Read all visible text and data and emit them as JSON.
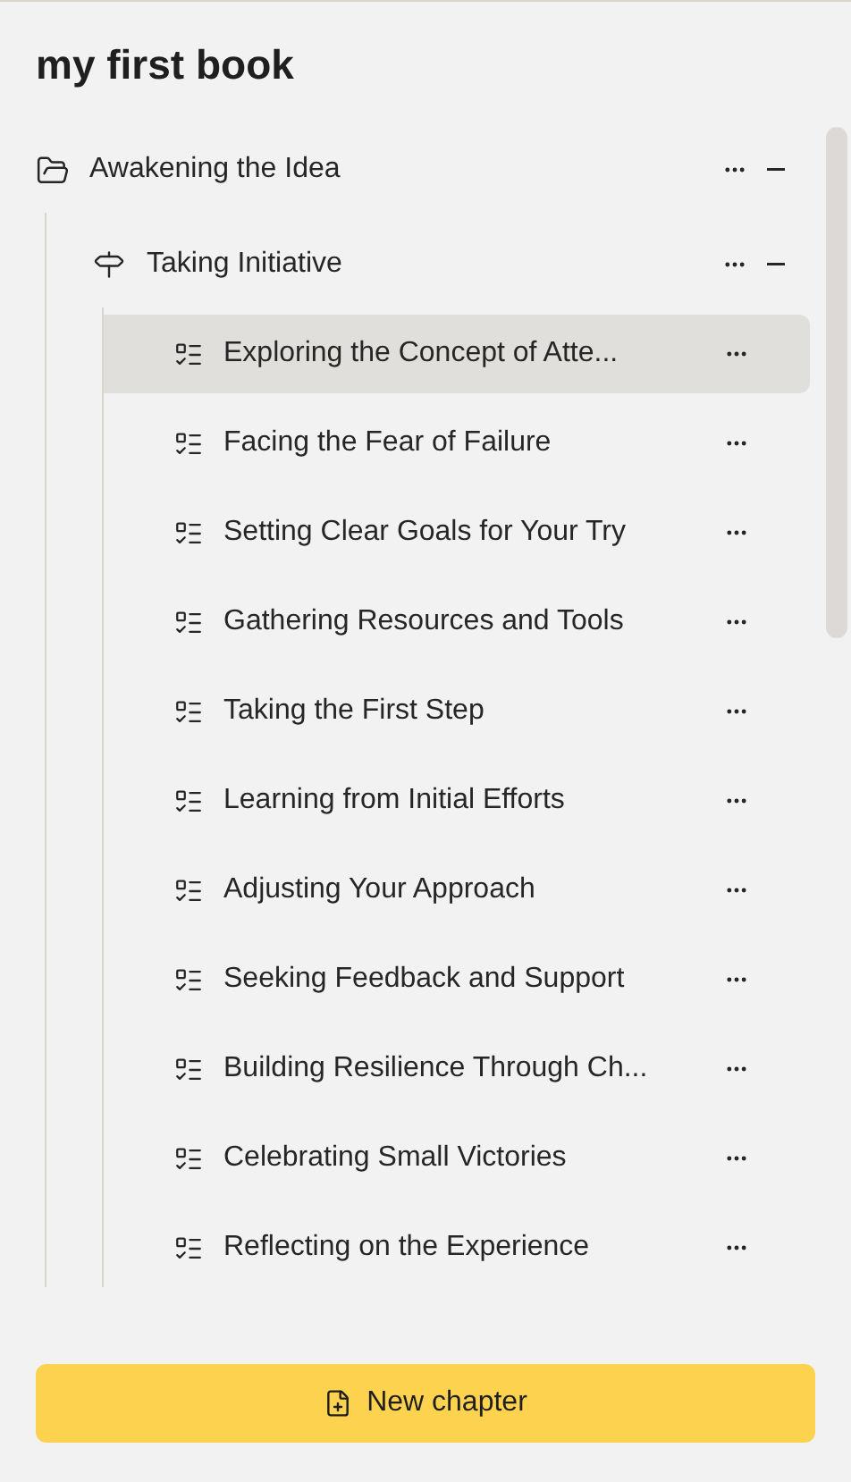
{
  "title": "my first book",
  "tree": [
    {
      "kind": "part",
      "label": "Awakening the Idea",
      "expanded": true,
      "children": [
        {
          "kind": "chapter",
          "label": "Taking Initiative",
          "expanded": true,
          "children": [
            {
              "kind": "section",
              "label": "Exploring the Concept of Atte...",
              "selected": true
            },
            {
              "kind": "section",
              "label": "Facing the Fear of Failure",
              "selected": false
            },
            {
              "kind": "section",
              "label": "Setting Clear Goals for Your Try",
              "selected": false
            },
            {
              "kind": "section",
              "label": "Gathering Resources and Tools",
              "selected": false
            },
            {
              "kind": "section",
              "label": "Taking the First Step",
              "selected": false
            },
            {
              "kind": "section",
              "label": "Learning from Initial Efforts",
              "selected": false
            },
            {
              "kind": "section",
              "label": "Adjusting Your Approach",
              "selected": false
            },
            {
              "kind": "section",
              "label": "Seeking Feedback and Support",
              "selected": false
            },
            {
              "kind": "section",
              "label": "Building Resilience Through Ch...",
              "selected": false
            },
            {
              "kind": "section",
              "label": "Celebrating Small Victories",
              "selected": false
            },
            {
              "kind": "section",
              "label": "Reflecting on the Experience",
              "selected": false
            }
          ]
        }
      ]
    }
  ],
  "new_chapter_button": "New chapter"
}
